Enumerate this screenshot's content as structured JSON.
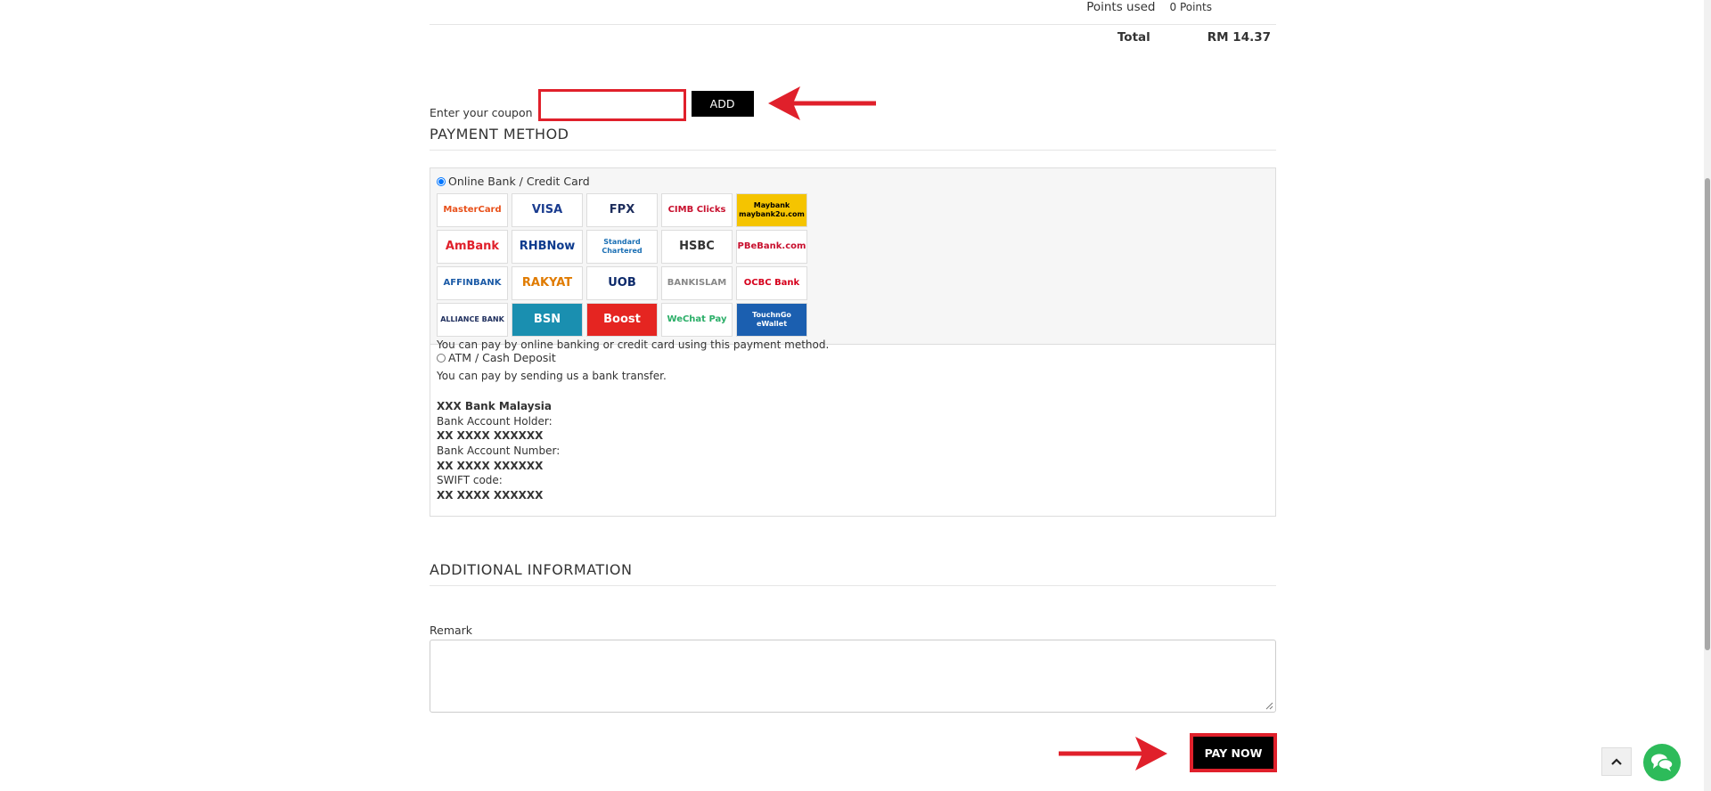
{
  "summary": {
    "points_label": "Points used",
    "points_value": "0 Points",
    "total_label": "Total",
    "total_value": "RM 14.37"
  },
  "coupon": {
    "label": "Enter your coupon",
    "value": "",
    "add_label": "ADD"
  },
  "payment": {
    "title": "PAYMENT METHOD",
    "option1_label": "Online Bank / Credit Card",
    "option1_selected": true,
    "option1_desc": "You can pay by online banking or credit card using this payment method.",
    "logos": [
      {
        "name": "MasterCard",
        "icon": "mastercard-logo",
        "color": "#e8501a",
        "bg": "#ffffff"
      },
      {
        "name": "VISA",
        "icon": "visa-logo",
        "color": "#1a3c8f",
        "bg": "#ffffff"
      },
      {
        "name": "FPX",
        "icon": "fpx-logo",
        "color": "#1d2d5c",
        "bg": "#ffffff"
      },
      {
        "name": "CIMB Clicks",
        "icon": "cimb-clicks-logo",
        "color": "#c8102e",
        "bg": "#ffffff"
      },
      {
        "name": "Maybank maybank2u.com",
        "icon": "maybank-logo",
        "color": "#000000",
        "bg": "#f5c400"
      },
      {
        "name": "AmBank",
        "icon": "ambank-logo",
        "color": "#e0202b",
        "bg": "#ffffff"
      },
      {
        "name": "RHBNow",
        "icon": "rhbnow-logo",
        "color": "#0d3b8e",
        "bg": "#ffffff"
      },
      {
        "name": "Standard Chartered",
        "icon": "standard-chartered-logo",
        "color": "#1a6fb4",
        "bg": "#ffffff"
      },
      {
        "name": "HSBC",
        "icon": "hsbc-logo",
        "color": "#333333",
        "bg": "#ffffff"
      },
      {
        "name": "PBeBank.com",
        "icon": "pbebank-logo",
        "color": "#c8102e",
        "bg": "#ffffff"
      },
      {
        "name": "AFFINBANK",
        "icon": "affinbank-logo",
        "color": "#1b5aa6",
        "bg": "#ffffff"
      },
      {
        "name": "RAKYAT",
        "icon": "bank-rakyat-logo",
        "color": "#e07b00",
        "bg": "#ffffff"
      },
      {
        "name": "UOB",
        "icon": "uob-logo",
        "color": "#0d2a6b",
        "bg": "#ffffff"
      },
      {
        "name": "BANKISLAM",
        "icon": "bank-islam-logo",
        "color": "#888888",
        "bg": "#ffffff"
      },
      {
        "name": "OCBC Bank",
        "icon": "ocbc-logo",
        "color": "#d6001c",
        "bg": "#ffffff"
      },
      {
        "name": "ALLIANCE BANK",
        "icon": "alliance-bank-logo",
        "color": "#1d2d5c",
        "bg": "#ffffff"
      },
      {
        "name": "BSN",
        "icon": "bsn-logo",
        "color": "#ffffff",
        "bg": "#1a8fb0"
      },
      {
        "name": "Boost",
        "icon": "boost-logo",
        "color": "#ffffff",
        "bg": "#e52521"
      },
      {
        "name": "WeChat Pay",
        "icon": "wechat-pay-logo",
        "color": "#2aae67",
        "bg": "#ffffff"
      },
      {
        "name": "TouchnGo eWallet",
        "icon": "touchngo-logo",
        "color": "#ffffff",
        "bg": "#1b5fb0"
      }
    ],
    "option2_label": "ATM / Cash Deposit",
    "option2_selected": false,
    "option2_desc": "You can pay by sending us a bank transfer.",
    "bank_name": "XXX Bank Malaysia",
    "holder_label": "Bank Account Holder:",
    "holder_value": "XX XXXX XXXXXX",
    "number_label": "Bank Account Number:",
    "number_value": "XX XXXX XXXXXX",
    "swift_label": "SWIFT code:",
    "swift_value": "XX XXXX XXXXXX"
  },
  "additional": {
    "title": "ADDITIONAL INFORMATION",
    "remark_label": "Remark",
    "remark_value": ""
  },
  "actions": {
    "pay_now_label": "PAY NOW"
  },
  "colors": {
    "highlight": "#e0202b",
    "chat": "#2dbb5a"
  }
}
